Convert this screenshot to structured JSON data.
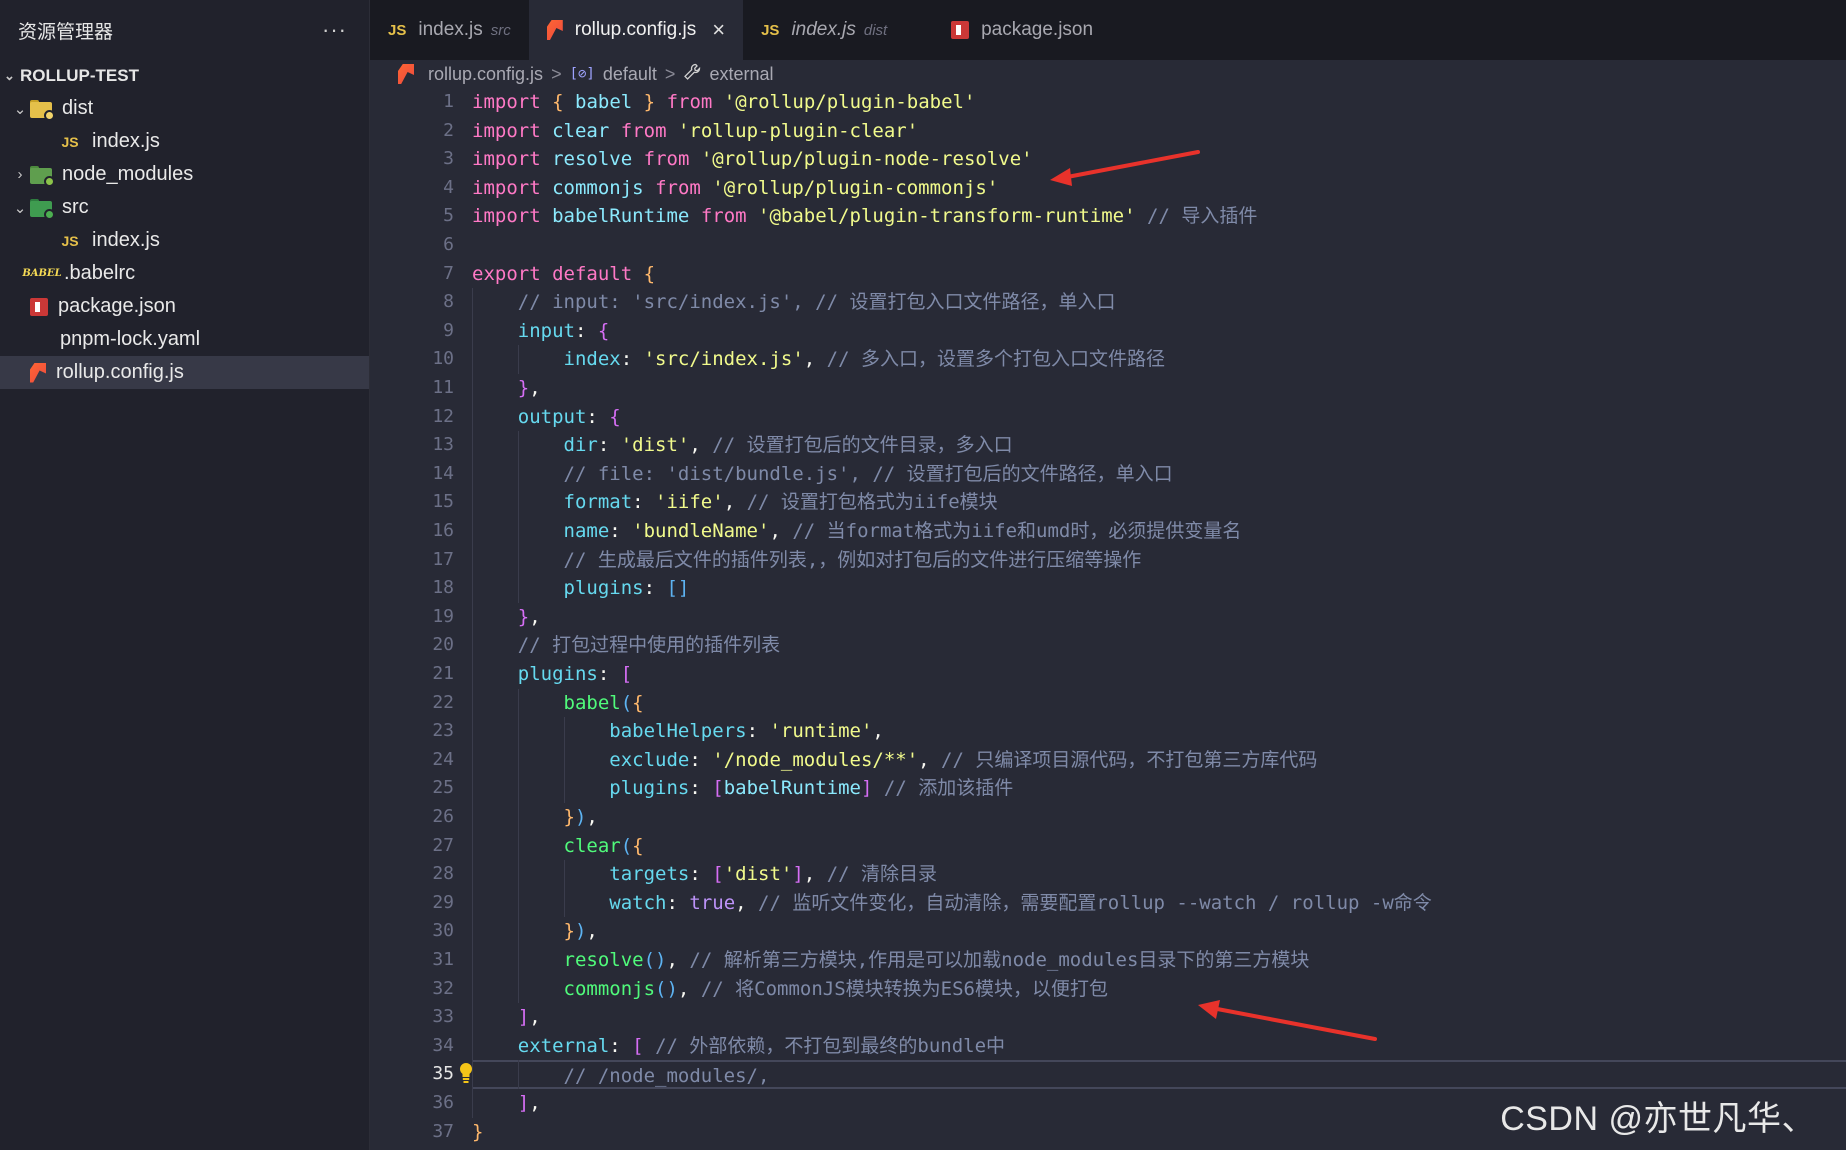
{
  "sidebar": {
    "title": "资源管理器",
    "more": "···",
    "project": "ROLLUP-TEST",
    "items": [
      {
        "label": "dist",
        "type": "folder-dist",
        "chevron": "⌄",
        "indent": 1
      },
      {
        "label": "index.js",
        "type": "js",
        "indent": 2
      },
      {
        "label": "node_modules",
        "type": "folder-node",
        "chevron": "›",
        "indent": 1
      },
      {
        "label": "src",
        "type": "folder-src",
        "chevron": "⌄",
        "indent": 1
      },
      {
        "label": "index.js",
        "type": "js",
        "indent": 2
      },
      {
        "label": ".babelrc",
        "type": "babel",
        "indent": 1
      },
      {
        "label": "package.json",
        "type": "npm",
        "indent": 1
      },
      {
        "label": "pnpm-lock.yaml",
        "type": "yaml",
        "indent": 1
      },
      {
        "label": "rollup.config.js",
        "type": "rollup",
        "indent": 1,
        "active": true
      }
    ]
  },
  "tabs": [
    {
      "label": "index.js",
      "hint": "src",
      "icon": "js-icon",
      "active": false,
      "italic": false
    },
    {
      "label": "rollup.config.js",
      "hint": "",
      "icon": "rollup-icon",
      "active": true,
      "italic": false,
      "close": "×"
    },
    {
      "label": "index.js",
      "hint": "dist",
      "icon": "js-icon",
      "active": false,
      "italic": true
    },
    {
      "label": "package.json",
      "hint": "",
      "icon": "npm-icon",
      "active": false,
      "italic": false
    }
  ],
  "breadcrumb": {
    "file": "rollup.config.js",
    "sep": ">",
    "symbol1": "default",
    "symbol2": "external",
    "var_icon": "[⊘]",
    "wrench_icon": "🔧"
  },
  "editor": {
    "current_line": 35,
    "lines": [
      [
        [
          "kw",
          "import"
        ],
        [
          "p",
          " "
        ],
        [
          "brace",
          "{"
        ],
        [
          "p",
          " "
        ],
        [
          "id",
          "babel"
        ],
        [
          "p",
          " "
        ],
        [
          "brace",
          "}"
        ],
        [
          "p",
          " "
        ],
        [
          "kw",
          "from"
        ],
        [
          "p",
          " "
        ],
        [
          "str",
          "'@rollup/plugin-babel'"
        ]
      ],
      [
        [
          "kw",
          "import"
        ],
        [
          "p",
          " "
        ],
        [
          "id",
          "clear"
        ],
        [
          "p",
          " "
        ],
        [
          "kw",
          "from"
        ],
        [
          "p",
          " "
        ],
        [
          "str",
          "'rollup-plugin-clear'"
        ]
      ],
      [
        [
          "kw",
          "import"
        ],
        [
          "p",
          " "
        ],
        [
          "id",
          "resolve"
        ],
        [
          "p",
          " "
        ],
        [
          "kw",
          "from"
        ],
        [
          "p",
          " "
        ],
        [
          "str",
          "'@rollup/plugin-node-resolve'"
        ]
      ],
      [
        [
          "kw",
          "import"
        ],
        [
          "p",
          " "
        ],
        [
          "id",
          "commonjs"
        ],
        [
          "p",
          " "
        ],
        [
          "kw",
          "from"
        ],
        [
          "p",
          " "
        ],
        [
          "str",
          "'@rollup/plugin-commonjs'"
        ]
      ],
      [
        [
          "kw",
          "import"
        ],
        [
          "p",
          " "
        ],
        [
          "id",
          "babelRuntime"
        ],
        [
          "p",
          " "
        ],
        [
          "kw",
          "from"
        ],
        [
          "p",
          " "
        ],
        [
          "str",
          "'@babel/plugin-transform-runtime'"
        ],
        [
          "p",
          " "
        ],
        [
          "cmt",
          "// 导入插件"
        ]
      ],
      [],
      [
        [
          "kw",
          "export"
        ],
        [
          "p",
          " "
        ],
        [
          "kw",
          "default"
        ],
        [
          "p",
          " "
        ],
        [
          "brace",
          "{"
        ]
      ],
      [
        [
          "p",
          "    "
        ],
        [
          "cmt",
          "// input: 'src/index.js', // 设置打包入口文件路径，单入口"
        ]
      ],
      [
        [
          "p",
          "    "
        ],
        [
          "prop",
          "input"
        ],
        [
          "p",
          ": "
        ],
        [
          "brace2",
          "{"
        ]
      ],
      [
        [
          "p",
          "        "
        ],
        [
          "prop",
          "index"
        ],
        [
          "p",
          ": "
        ],
        [
          "str",
          "'src/index.js'"
        ],
        [
          "p",
          ", "
        ],
        [
          "cmt",
          "// 多入口，设置多个打包入口文件路径"
        ]
      ],
      [
        [
          "p",
          "    "
        ],
        [
          "brace2",
          "}"
        ],
        [
          "p",
          ","
        ]
      ],
      [
        [
          "p",
          "    "
        ],
        [
          "prop",
          "output"
        ],
        [
          "p",
          ": "
        ],
        [
          "brace2",
          "{"
        ]
      ],
      [
        [
          "p",
          "        "
        ],
        [
          "prop",
          "dir"
        ],
        [
          "p",
          ": "
        ],
        [
          "str",
          "'dist'"
        ],
        [
          "p",
          ", "
        ],
        [
          "cmt",
          "// 设置打包后的文件目录，多入口"
        ]
      ],
      [
        [
          "p",
          "        "
        ],
        [
          "cmt",
          "// file: 'dist/bundle.js', // 设置打包后的文件路径，单入口"
        ]
      ],
      [
        [
          "p",
          "        "
        ],
        [
          "prop",
          "format"
        ],
        [
          "p",
          ": "
        ],
        [
          "str",
          "'iife'"
        ],
        [
          "p",
          ", "
        ],
        [
          "cmt",
          "// 设置打包格式为iife模块"
        ]
      ],
      [
        [
          "p",
          "        "
        ],
        [
          "prop",
          "name"
        ],
        [
          "p",
          ": "
        ],
        [
          "str",
          "'bundleName'"
        ],
        [
          "p",
          ", "
        ],
        [
          "cmt",
          "// 当format格式为iife和umd时，必须提供变量名"
        ]
      ],
      [
        [
          "p",
          "        "
        ],
        [
          "cmt",
          "// 生成最后文件的插件列表,，例如对打包后的文件进行压缩等操作"
        ]
      ],
      [
        [
          "p",
          "        "
        ],
        [
          "prop",
          "plugins"
        ],
        [
          "p",
          ": "
        ],
        [
          "brace3",
          "[]"
        ]
      ],
      [
        [
          "p",
          "    "
        ],
        [
          "brace2",
          "}"
        ],
        [
          "p",
          ","
        ]
      ],
      [
        [
          "p",
          "    "
        ],
        [
          "cmt",
          "// 打包过程中使用的插件列表"
        ]
      ],
      [
        [
          "p",
          "    "
        ],
        [
          "prop",
          "plugins"
        ],
        [
          "p",
          ": "
        ],
        [
          "brace2",
          "["
        ]
      ],
      [
        [
          "p",
          "        "
        ],
        [
          "fn",
          "babel"
        ],
        [
          "brace3",
          "("
        ],
        [
          "brace",
          "{"
        ]
      ],
      [
        [
          "p",
          "            "
        ],
        [
          "prop",
          "babelHelpers"
        ],
        [
          "p",
          ": "
        ],
        [
          "str",
          "'runtime'"
        ],
        [
          "p",
          ","
        ]
      ],
      [
        [
          "p",
          "            "
        ],
        [
          "prop",
          "exclude"
        ],
        [
          "p",
          ": "
        ],
        [
          "str",
          "'/node_modules/**'"
        ],
        [
          "p",
          ", "
        ],
        [
          "cmt",
          "// 只编译项目源代码，不打包第三方库代码"
        ]
      ],
      [
        [
          "p",
          "            "
        ],
        [
          "prop",
          "plugins"
        ],
        [
          "p",
          ": "
        ],
        [
          "brace2",
          "["
        ],
        [
          "id",
          "babelRuntime"
        ],
        [
          "brace2",
          "]"
        ],
        [
          "p",
          " "
        ],
        [
          "cmt",
          "// 添加该插件"
        ]
      ],
      [
        [
          "p",
          "        "
        ],
        [
          "brace",
          "}"
        ],
        [
          "brace3",
          ")"
        ],
        [
          "p",
          ","
        ]
      ],
      [
        [
          "p",
          "        "
        ],
        [
          "fn",
          "clear"
        ],
        [
          "brace3",
          "("
        ],
        [
          "brace",
          "{"
        ]
      ],
      [
        [
          "p",
          "            "
        ],
        [
          "prop",
          "targets"
        ],
        [
          "p",
          ": "
        ],
        [
          "brace2",
          "["
        ],
        [
          "str",
          "'dist'"
        ],
        [
          "brace2",
          "]"
        ],
        [
          "p",
          ", "
        ],
        [
          "cmt",
          "// 清除目录"
        ]
      ],
      [
        [
          "p",
          "            "
        ],
        [
          "prop",
          "watch"
        ],
        [
          "p",
          ": "
        ],
        [
          "bool",
          "true"
        ],
        [
          "p",
          ", "
        ],
        [
          "cmt",
          "// 监听文件变化，自动清除，需要配置rollup --watch / rollup -w命令"
        ]
      ],
      [
        [
          "p",
          "        "
        ],
        [
          "brace",
          "}"
        ],
        [
          "brace3",
          ")"
        ],
        [
          "p",
          ","
        ]
      ],
      [
        [
          "p",
          "        "
        ],
        [
          "fn",
          "resolve"
        ],
        [
          "brace3",
          "()"
        ],
        [
          "p",
          ", "
        ],
        [
          "cmt",
          "// 解析第三方模块,作用是可以加载node_modules目录下的第三方模块"
        ]
      ],
      [
        [
          "p",
          "        "
        ],
        [
          "fn",
          "commonjs"
        ],
        [
          "brace3",
          "()"
        ],
        [
          "p",
          ", "
        ],
        [
          "cmt",
          "// 将CommonJS模块转换为ES6模块，以便打包"
        ]
      ],
      [
        [
          "p",
          "    "
        ],
        [
          "brace2",
          "]"
        ],
        [
          "p",
          ","
        ]
      ],
      [
        [
          "p",
          "    "
        ],
        [
          "prop",
          "external"
        ],
        [
          "p",
          ": "
        ],
        [
          "brace2",
          "["
        ],
        [
          "p",
          " "
        ],
        [
          "cmt",
          "// 外部依赖，不打包到最终的bundle中"
        ]
      ],
      [
        [
          "p",
          "        "
        ],
        [
          "cmt",
          "// /node_modules/,"
        ]
      ],
      [
        [
          "p",
          "    "
        ],
        [
          "brace2",
          "]"
        ],
        [
          "p",
          ","
        ]
      ],
      [
        [
          "brace",
          "}"
        ]
      ]
    ]
  },
  "colors": {
    "arrow": "#e8322b",
    "lightbulb": "#f5c518"
  },
  "watermark": "CSDN @亦世凡华、"
}
